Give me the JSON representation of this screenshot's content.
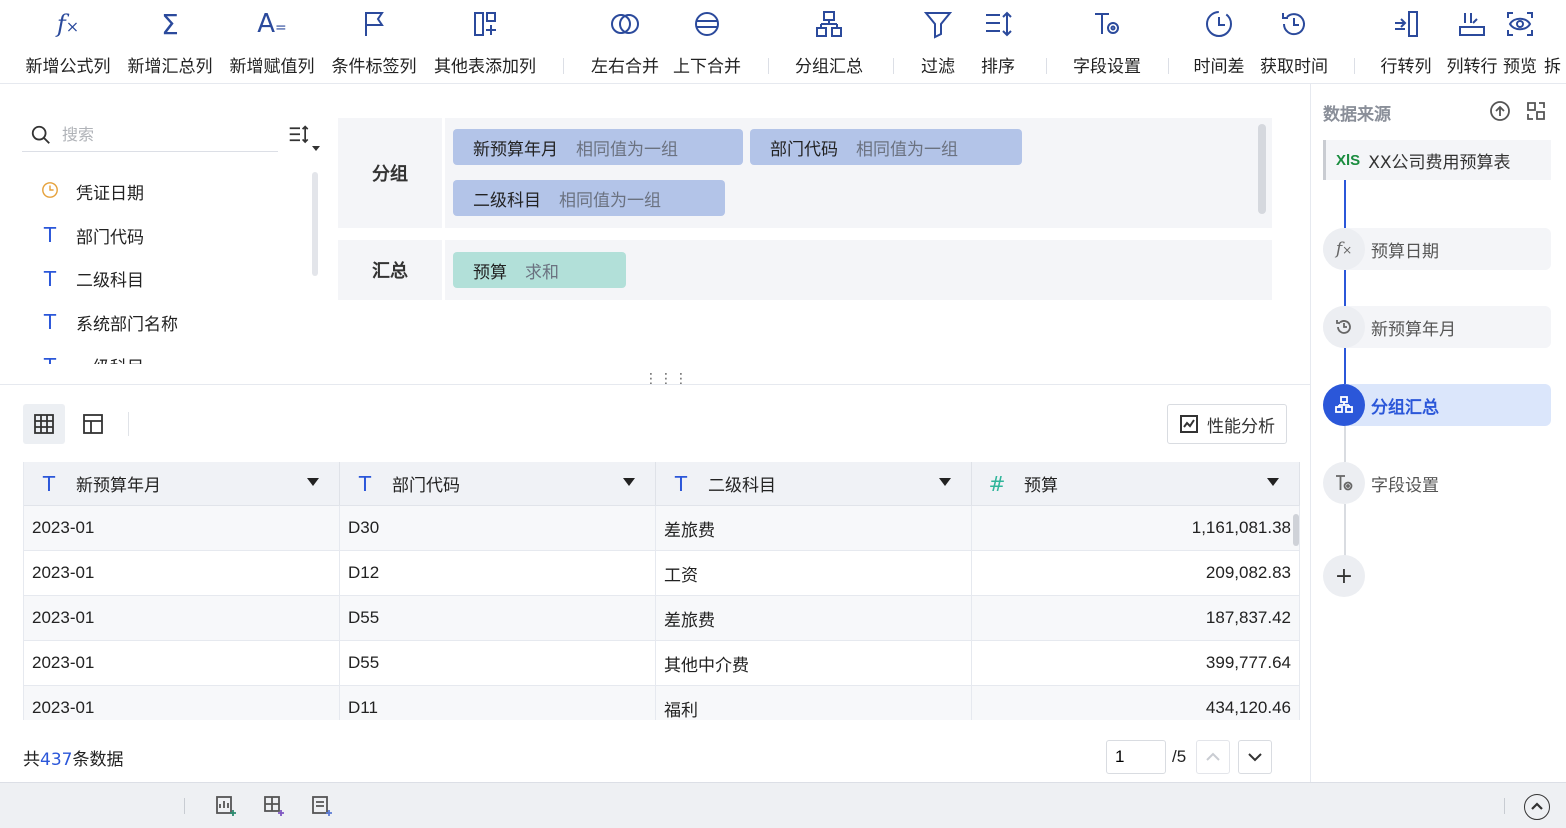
{
  "toolbar": {
    "items": [
      {
        "label": "新增公式列",
        "icon": "formula-icon"
      },
      {
        "label": "新增汇总列",
        "icon": "sigma-icon"
      },
      {
        "label": "新增赋值列",
        "icon": "assign-icon"
      },
      {
        "label": "条件标签列",
        "icon": "flag-icon"
      },
      {
        "label": "其他表添加列",
        "icon": "add-column-icon"
      },
      {
        "label": "左右合并",
        "icon": "merge-horizontal-icon"
      },
      {
        "label": "上下合并",
        "icon": "merge-vertical-icon"
      },
      {
        "label": "分组汇总",
        "icon": "group-summary-icon"
      },
      {
        "label": "过滤",
        "icon": "filter-icon"
      },
      {
        "label": "排序",
        "icon": "sort-icon"
      },
      {
        "label": "字段设置",
        "icon": "field-settings-icon"
      },
      {
        "label": "时间差",
        "icon": "time-diff-icon"
      },
      {
        "label": "获取时间",
        "icon": "get-time-icon"
      },
      {
        "label": "行转列",
        "icon": "row-to-column-icon"
      },
      {
        "label": "列转行",
        "icon": "column-to-row-icon"
      },
      {
        "label": "预览",
        "icon": "preview-icon"
      },
      {
        "label": "拆",
        "icon": "split-icon"
      }
    ]
  },
  "fields": {
    "search_placeholder": "搜索",
    "items": [
      {
        "label": "凭证日期",
        "type": "date"
      },
      {
        "label": "部门代码",
        "type": "text"
      },
      {
        "label": "二级科目",
        "type": "text"
      },
      {
        "label": "系统部门名称",
        "type": "text"
      },
      {
        "label": "一级科目",
        "type": "text"
      }
    ]
  },
  "group": {
    "label": "分组",
    "chips": [
      {
        "name": "新预算年月",
        "mode": "相同值为一组"
      },
      {
        "name": "部门代码",
        "mode": "相同值为一组"
      },
      {
        "name": "二级科目",
        "mode": "相同值为一组"
      }
    ]
  },
  "summary": {
    "label": "汇总",
    "chips": [
      {
        "name": "预算",
        "mode": "求和"
      }
    ]
  },
  "perf_button": "性能分析",
  "table": {
    "columns": [
      {
        "label": "新预算年月",
        "type": "text"
      },
      {
        "label": "部门代码",
        "type": "text"
      },
      {
        "label": "二级科目",
        "type": "text"
      },
      {
        "label": "预算",
        "type": "number"
      }
    ],
    "rows": [
      [
        "2023-01",
        "D30",
        "差旅费",
        "1,161,081.38"
      ],
      [
        "2023-01",
        "D12",
        "工资",
        "209,082.83"
      ],
      [
        "2023-01",
        "D55",
        "差旅费",
        "187,837.42"
      ],
      [
        "2023-01",
        "D55",
        "其他中介费",
        "399,777.64"
      ],
      [
        "2023-01",
        "D11",
        "福利",
        "434,120.46"
      ]
    ]
  },
  "footer": {
    "count_prefix": "共",
    "count": "437",
    "count_suffix": "条数据",
    "page": "1",
    "page_total": "/5"
  },
  "flow": {
    "title": "数据来源",
    "source": "XX公司费用预算表",
    "source_badge": "XlS",
    "steps": [
      {
        "label": "预算日期",
        "icon": "formula-icon"
      },
      {
        "label": "新预算年月",
        "icon": "get-time-icon"
      },
      {
        "label": "分组汇总",
        "icon": "group-summary-icon",
        "active": true
      },
      {
        "label": "字段设置",
        "icon": "field-settings-icon"
      }
    ],
    "add_label": "+"
  },
  "colors": {
    "accent": "#2b57d9",
    "group_chip": "#b3c4e8",
    "summary_chip": "#b2e0d9",
    "panel_bg": "#f4f5f8"
  }
}
